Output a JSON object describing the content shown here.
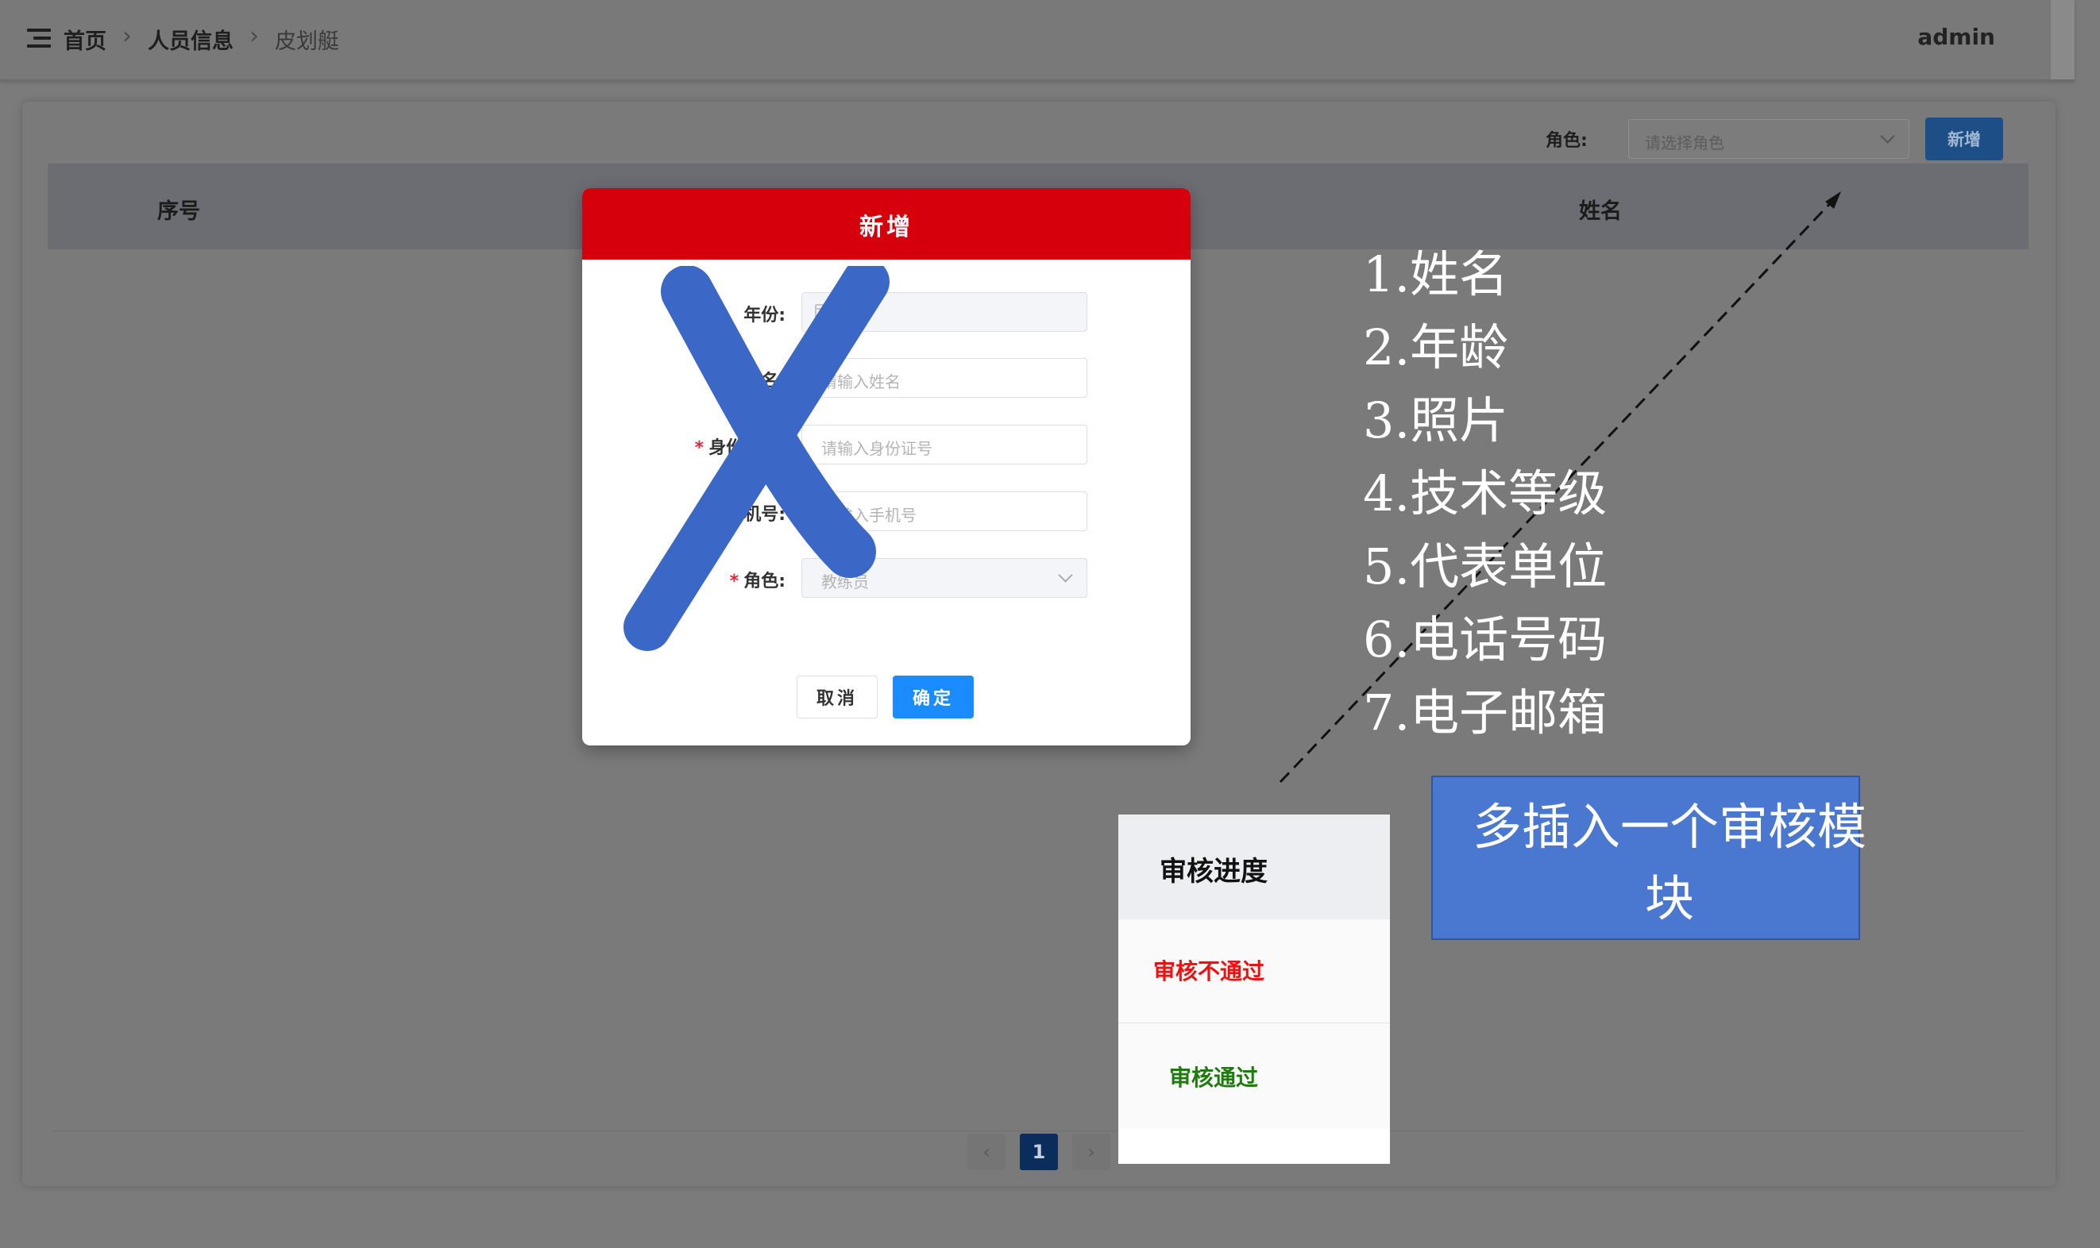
{
  "header": {
    "breadcrumb": [
      "首页",
      "人员信息",
      "皮划艇"
    ],
    "user": "admin",
    "icons": [
      "menu-icon",
      "chevron-right-icon"
    ]
  },
  "toolbar": {
    "role_label": "角色:",
    "role_placeholder": "请选择角色",
    "add_label": "新增"
  },
  "table": {
    "columns": [
      "序号",
      "姓名"
    ],
    "rows": []
  },
  "pagination": {
    "current_page": "1",
    "prev": "‹",
    "next": "›"
  },
  "modal": {
    "title": "新增",
    "fields": [
      {
        "label": "年份:",
        "placeholder": "",
        "required": false,
        "icon": "calendar-icon",
        "disabled": true
      },
      {
        "label": "姓名:",
        "placeholder": "请输入姓名",
        "required": true
      },
      {
        "label": "身份证号:",
        "placeholder": "请输入身份证号",
        "required": true
      },
      {
        "label": "手机号:",
        "placeholder": "请输入手机号",
        "required": false
      },
      {
        "label": "角色:",
        "placeholder": "教练员",
        "required": true,
        "disabled": true
      }
    ],
    "cancel_label": "取消",
    "ok_label": "确定"
  },
  "annotations": {
    "list": [
      "1.姓名",
      "2.年龄",
      "3.照片",
      "4.技术等级",
      "5.代表单位",
      "6.电话号码",
      "7.电子邮箱"
    ],
    "note_lines": [
      "多插入一个审核模",
      "块"
    ],
    "review_panel": {
      "title": "审核进度",
      "fail_label": "审核不通过",
      "pass_label": "审核通过"
    },
    "colors": {
      "fail": "#ee1111",
      "pass": "#1f7a0f",
      "modal_header": "#d6000c",
      "note_box": "#4a78d0"
    }
  }
}
